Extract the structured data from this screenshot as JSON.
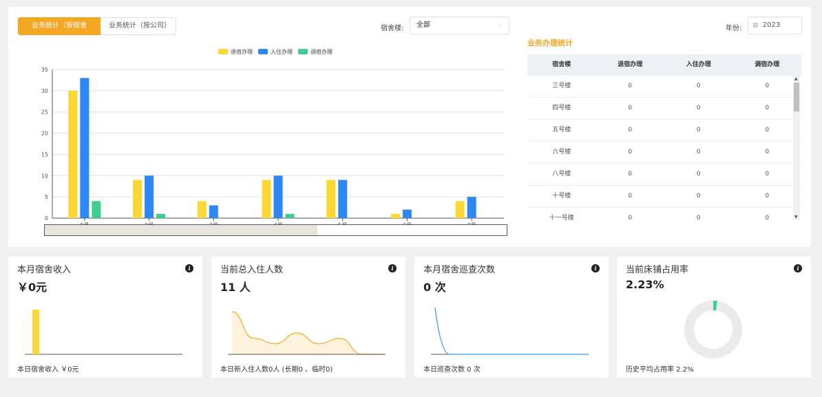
{
  "tabs": [
    {
      "label": "业务统计（按宿舍楼）"
    },
    {
      "label": "业务统计（按公司）"
    }
  ],
  "filter": {
    "building_label": "宿舍楼:",
    "building_value": "全部",
    "year_label": "年份:",
    "year_value": "2023"
  },
  "colors": {
    "accent": "#f5a623",
    "checkout": "#fdd835",
    "checkin": "#2e87f7",
    "transfer": "#3ecf8e"
  },
  "chart_data": {
    "type": "bar",
    "categories": [
      "1月",
      "2月",
      "3月",
      "4月",
      "5月",
      "6月",
      "7月"
    ],
    "series": [
      {
        "name": "退宿办理",
        "color": "#fdd835",
        "values": [
          30,
          9,
          4,
          9,
          9,
          1,
          4
        ]
      },
      {
        "name": "入住办理",
        "color": "#2e87f7",
        "values": [
          33,
          10,
          3,
          10,
          9,
          2,
          5
        ]
      },
      {
        "name": "调宿办理",
        "color": "#3ecf8e",
        "values": [
          4,
          1,
          0,
          1,
          0,
          0,
          0
        ]
      }
    ],
    "ylim": [
      0,
      35
    ],
    "yticks": [
      0,
      5,
      10,
      15,
      20,
      25,
      30,
      35
    ],
    "grid": true,
    "legend": "top-center",
    "zoom_window": [
      0,
      0.59
    ]
  },
  "stats": {
    "title": "业务办理统计",
    "headers": [
      "宿舍楼",
      "退宿办理",
      "入住办理",
      "调宿办理"
    ],
    "rows": [
      [
        "三号楼",
        "0",
        "0",
        "0"
      ],
      [
        "四号楼",
        "0",
        "0",
        "0"
      ],
      [
        "五号楼",
        "0",
        "0",
        "0"
      ],
      [
        "六号楼",
        "0",
        "0",
        "0"
      ],
      [
        "八号楼",
        "0",
        "0",
        "0"
      ],
      [
        "十号楼",
        "0",
        "0",
        "0"
      ],
      [
        "十一号楼",
        "0",
        "0",
        "0"
      ]
    ]
  },
  "cards": [
    {
      "title": "本月宿舍收入",
      "value": "￥0元",
      "footer": "本日宿舍收入 ￥0元",
      "mini_bar_values": [
        1
      ]
    },
    {
      "title": "当前总入住人数",
      "value": "11 人",
      "footer": "本日新入住人数0人 (长期0 、临时0)",
      "trend_values": [
        8,
        3,
        2,
        4,
        2,
        3,
        0,
        0
      ]
    },
    {
      "title": "本月宿舍巡查次数",
      "value": "0 次",
      "footer": "本日巡查次数 0 次",
      "trend_values": [
        6,
        0,
        0,
        0,
        0,
        0,
        0
      ]
    },
    {
      "title": "当前床铺占用率",
      "value": "2.23%",
      "footer": "历史平均占用率 2.2%",
      "occupancy_fraction": 0.0223
    }
  ]
}
